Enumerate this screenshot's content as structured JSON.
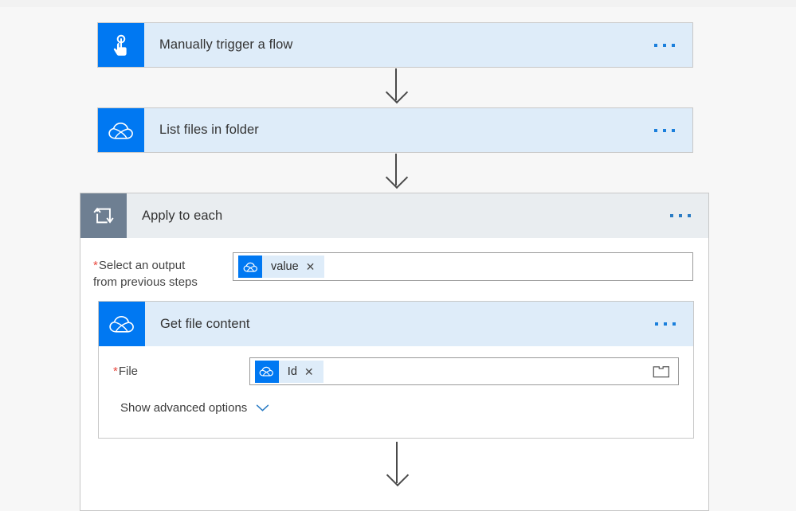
{
  "canvas": {
    "background_color": "#f7f7f7",
    "accent_blue": "#0078f2",
    "token_fill": "#deecf9",
    "loop_header_gray": "#e9edf0",
    "loop_icon_gray": "#6e7f92",
    "required_star_color": "#e8493f"
  },
  "nodes": {
    "trigger": {
      "title": "Manually trigger a flow",
      "icon": "tap-finger-icon",
      "menu_label": "..."
    },
    "list_files": {
      "title": "List files in folder",
      "icon": "onedrive-cloud-icon",
      "menu_label": "..."
    },
    "apply_to_each": {
      "title": "Apply to each",
      "icon": "loop-repeat-icon",
      "menu_label": "...",
      "output_field": {
        "label_line1": "Select an output",
        "label_line2": "from previous steps",
        "required": true,
        "required_marker": "*",
        "token": {
          "label": "value",
          "icon": "onedrive-cloud-icon",
          "remove_label": "✕"
        }
      }
    },
    "get_file_content": {
      "title": "Get file content",
      "icon": "onedrive-cloud-icon",
      "menu_label": "...",
      "file_field": {
        "label": "File",
        "required": true,
        "required_marker": "*",
        "token": {
          "label": "Id",
          "icon": "onedrive-cloud-icon",
          "remove_label": "✕"
        },
        "picker_icon": "folder-picker-icon"
      },
      "advanced_options": {
        "label": "Show advanced options",
        "chevron_icon": "chevron-down-icon"
      }
    }
  },
  "connectors": [
    {
      "name": "trigger-to-list-files",
      "icon": "arrow-down-icon"
    },
    {
      "name": "list-files-to-apply-to-each",
      "icon": "arrow-down-icon"
    },
    {
      "name": "get-file-content-to-next",
      "icon": "arrow-down-icon"
    }
  ]
}
